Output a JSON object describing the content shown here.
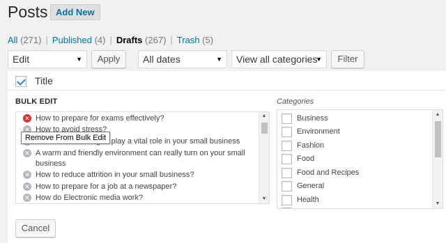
{
  "header": {
    "title": "Posts",
    "add_new": "Add New"
  },
  "status_filters": [
    {
      "label": "All",
      "count": "(271)"
    },
    {
      "label": "Published",
      "count": "(4)"
    },
    {
      "label": "Drafts",
      "count": "(267)"
    },
    {
      "label": "Trash",
      "count": "(5)"
    }
  ],
  "toolbar": {
    "bulk_action": "Edit",
    "apply": "Apply",
    "dates": "All dates",
    "categories": "View all categories",
    "filter": "Filter"
  },
  "table": {
    "title_column": "Title"
  },
  "bulk_edit": {
    "heading": "BULK EDIT",
    "categories_label": "Categories",
    "tooltip": "Remove From Bulk Edit",
    "posts": [
      "How to prepare for exams effectively?",
      "How to avoid stress?",
      "...gan play a vital role in your small business",
      "A warm and friendly environment can really turn on your small",
      "business",
      "How to reduce attrition in your small business?",
      "How to prepare for a job at a newspaper?",
      "How do Electronic media work?"
    ],
    "categories": [
      "Business",
      "Environment",
      "Fashion",
      "Food",
      "Food and Recipes",
      "General",
      "Health"
    ],
    "cancel": "Cancel"
  },
  "colors": {
    "accent": "#0073aa",
    "remove_active": "#dc3232",
    "check": "#1e8cbe"
  }
}
